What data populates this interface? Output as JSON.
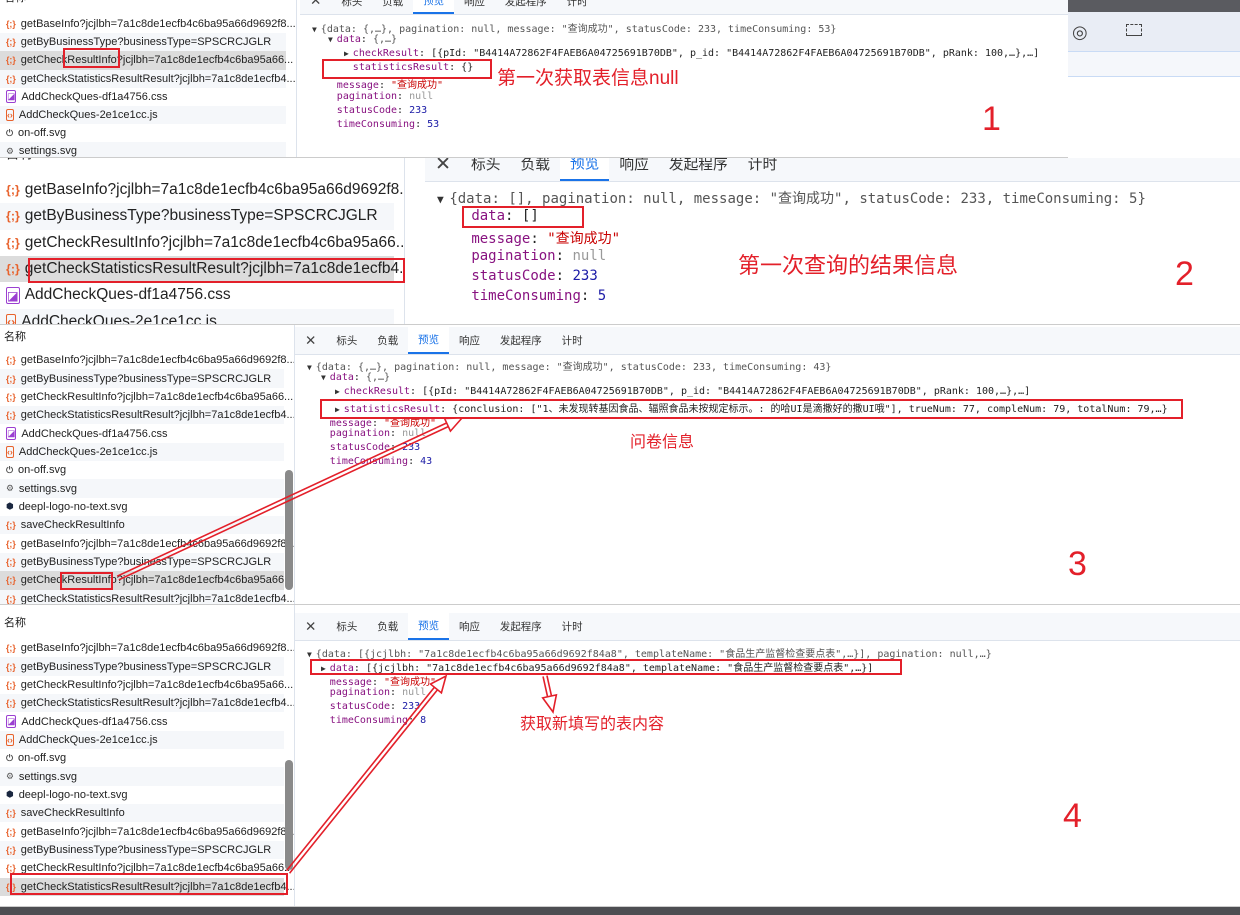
{
  "tabs": [
    "标头",
    "负载",
    "预览",
    "响应",
    "发起程序",
    "计时"
  ],
  "active_tab": "预览",
  "list_header": "名称",
  "colors": {
    "accent": "#1a73e8",
    "annotation": "#e3202a",
    "key": "#881280",
    "string": "#c80000",
    "number": "#1a1aa6"
  },
  "panels": [
    {
      "number": "1",
      "note": "第一次获取表信息null",
      "rows": [
        {
          "icon": "json",
          "name": "getBaseInfo?jcjlbh=7a1c8de1ecfb4c6ba95a66d9692f8..."
        },
        {
          "icon": "json",
          "name": "getByBusinessType?businessType=SPSCRCJGLR"
        },
        {
          "icon": "json",
          "name": "getCheckResultInfo?jcjlbh=7a1c8de1ecfb4c6ba95a66...",
          "selected": true
        },
        {
          "icon": "json",
          "name": "getCheckStatisticsResultResult?jcjlbh=7a1c8de1ecfb4..."
        },
        {
          "icon": "css",
          "name": "AddCheckQues-df1a4756.css"
        },
        {
          "icon": "js",
          "name": "AddCheckQues-2e1ce1cc.js"
        },
        {
          "icon": "power",
          "name": "on-off.svg"
        },
        {
          "icon": "gear",
          "name": "settings.svg"
        }
      ],
      "json": [
        {
          "indent": 0,
          "arrow": "down",
          "key": "",
          "value": "{data: {,…}, pagination: null, message: \"查询成功\", statusCode: 233, timeConsuming: 53}",
          "type": "summary"
        },
        {
          "indent": 1,
          "arrow": "down",
          "key": "data",
          "value": "{,…}",
          "type": "summary"
        },
        {
          "indent": 2,
          "arrow": "right",
          "key": "checkResult",
          "value": "[{pId: \"B4414A72862F4FAEB6A04725691B70DB\", p_id: \"B4414A72862F4FAEB6A04725691B70DB\", pRank: 100,…},…]",
          "type": "plain"
        },
        {
          "indent": 2,
          "arrow": "",
          "key": "statisticsResult",
          "value": "{}",
          "type": "plain"
        },
        {
          "indent": 1,
          "arrow": "",
          "key": "message",
          "value": "\"查询成功\"",
          "type": "string"
        },
        {
          "indent": 1,
          "arrow": "",
          "key": "pagination",
          "value": "null",
          "type": "null"
        },
        {
          "indent": 1,
          "arrow": "",
          "key": "statusCode",
          "value": "233",
          "type": "number"
        },
        {
          "indent": 1,
          "arrow": "",
          "key": "timeConsuming",
          "value": "53",
          "type": "number"
        }
      ]
    },
    {
      "number": "2",
      "note": "第一次查询的结果信息",
      "rows": [
        {
          "icon": "json",
          "name": "getBaseInfo?jcjlbh=7a1c8de1ecfb4c6ba95a66d9692f8..."
        },
        {
          "icon": "json",
          "name": "getByBusinessType?businessType=SPSCRCJGLR"
        },
        {
          "icon": "json",
          "name": "getCheckResultInfo?jcjlbh=7a1c8de1ecfb4c6ba95a66..."
        },
        {
          "icon": "json",
          "name": "getCheckStatisticsResultResult?jcjlbh=7a1c8de1ecfb4...",
          "selected": true
        },
        {
          "icon": "css",
          "name": "AddCheckQues-df1a4756.css"
        },
        {
          "icon": "js",
          "name": "AddCheckQues-2e1ce1cc.js"
        }
      ],
      "json": [
        {
          "indent": 0,
          "arrow": "down",
          "key": "",
          "value": "{data: [], pagination: null, message: \"查询成功\", statusCode: 233, timeConsuming: 5}",
          "type": "summary"
        },
        {
          "indent": 1,
          "arrow": "",
          "key": "data",
          "value": "[]",
          "type": "plain"
        },
        {
          "indent": 1,
          "arrow": "",
          "key": "message",
          "value": "\"查询成功\"",
          "type": "string"
        },
        {
          "indent": 1,
          "arrow": "",
          "key": "pagination",
          "value": "null",
          "type": "null"
        },
        {
          "indent": 1,
          "arrow": "",
          "key": "statusCode",
          "value": "233",
          "type": "number"
        },
        {
          "indent": 1,
          "arrow": "",
          "key": "timeConsuming",
          "value": "5",
          "type": "number"
        }
      ]
    },
    {
      "number": "3",
      "note": "问卷信息",
      "rows": [
        {
          "icon": "json",
          "name": "getBaseInfo?jcjlbh=7a1c8de1ecfb4c6ba95a66d9692f8..."
        },
        {
          "icon": "json",
          "name": "getByBusinessType?businessType=SPSCRCJGLR"
        },
        {
          "icon": "json",
          "name": "getCheckResultInfo?jcjlbh=7a1c8de1ecfb4c6ba95a66..."
        },
        {
          "icon": "json",
          "name": "getCheckStatisticsResultResult?jcjlbh=7a1c8de1ecfb4..."
        },
        {
          "icon": "css",
          "name": "AddCheckQues-df1a4756.css"
        },
        {
          "icon": "js",
          "name": "AddCheckQues-2e1ce1cc.js"
        },
        {
          "icon": "power",
          "name": "on-off.svg"
        },
        {
          "icon": "gear",
          "name": "settings.svg"
        },
        {
          "icon": "deepl",
          "name": "deepl-logo-no-text.svg"
        },
        {
          "icon": "json",
          "name": "saveCheckResultInfo"
        },
        {
          "icon": "json",
          "name": "getBaseInfo?jcjlbh=7a1c8de1ecfb4c6ba95a66d9692f8..."
        },
        {
          "icon": "json",
          "name": "getByBusinessType?businessType=SPSCRCJGLR"
        },
        {
          "icon": "json",
          "name": "getCheckResultInfo?jcjlbh=7a1c8de1ecfb4c6ba95a66...",
          "selected": true
        },
        {
          "icon": "json",
          "name": "getCheckStatisticsResultResult?jcjlbh=7a1c8de1ecfb4..."
        }
      ],
      "json": [
        {
          "indent": 0,
          "arrow": "down",
          "key": "",
          "value": "{data: {,…}, pagination: null, message: \"查询成功\", statusCode: 233, timeConsuming: 43}",
          "type": "summary"
        },
        {
          "indent": 1,
          "arrow": "down",
          "key": "data",
          "value": "{,…}",
          "type": "summary"
        },
        {
          "indent": 2,
          "arrow": "right",
          "key": "checkResult",
          "value": "[{pId: \"B4414A72862F4FAEB6A04725691B70DB\", p_id: \"B4414A72862F4FAEB6A04725691B70DB\", pRank: 100,…},…]",
          "type": "plain"
        },
        {
          "indent": 2,
          "arrow": "right",
          "key": "statisticsResult",
          "value": "{conclusion: [\"1、未发现转基因食品、辐照食品未按规定标示。: 的哈UI是滴撒好的撒UI哦\"], trueNum: 77, compleNum: 79, totalNum: 79,…}",
          "type": "plain"
        },
        {
          "indent": 1,
          "arrow": "",
          "key": "message",
          "value": "\"查询成功\"",
          "type": "string"
        },
        {
          "indent": 1,
          "arrow": "",
          "key": "pagination",
          "value": "null",
          "type": "null"
        },
        {
          "indent": 1,
          "arrow": "",
          "key": "statusCode",
          "value": "233",
          "type": "number"
        },
        {
          "indent": 1,
          "arrow": "",
          "key": "timeConsuming",
          "value": "43",
          "type": "number"
        }
      ]
    },
    {
      "number": "4",
      "note": "获取新填写的表内容",
      "rows": [
        {
          "icon": "json",
          "name": "getBaseInfo?jcjlbh=7a1c8de1ecfb4c6ba95a66d9692f8..."
        },
        {
          "icon": "json",
          "name": "getByBusinessType?businessType=SPSCRCJGLR"
        },
        {
          "icon": "json",
          "name": "getCheckResultInfo?jcjlbh=7a1c8de1ecfb4c6ba95a66..."
        },
        {
          "icon": "json",
          "name": "getCheckStatisticsResultResult?jcjlbh=7a1c8de1ecfb4..."
        },
        {
          "icon": "css",
          "name": "AddCheckQues-df1a4756.css"
        },
        {
          "icon": "js",
          "name": "AddCheckQues-2e1ce1cc.js"
        },
        {
          "icon": "power",
          "name": "on-off.svg"
        },
        {
          "icon": "gear",
          "name": "settings.svg"
        },
        {
          "icon": "deepl",
          "name": "deepl-logo-no-text.svg"
        },
        {
          "icon": "json",
          "name": "saveCheckResultInfo"
        },
        {
          "icon": "json",
          "name": "getBaseInfo?jcjlbh=7a1c8de1ecfb4c6ba95a66d9692f8..."
        },
        {
          "icon": "json",
          "name": "getByBusinessType?businessType=SPSCRCJGLR"
        },
        {
          "icon": "json",
          "name": "getCheckResultInfo?jcjlbh=7a1c8de1ecfb4c6ba95a66..."
        },
        {
          "icon": "json",
          "name": "getCheckStatisticsResultResult?jcjlbh=7a1c8de1ecfb4...",
          "selected": true
        }
      ],
      "json": [
        {
          "indent": 0,
          "arrow": "down",
          "key": "",
          "value": "{data: [{jcjlbh: \"7a1c8de1ecfb4c6ba95a66d9692f84a8\", templateName: \"食品生产监督检查要点表\",…}], pagination: null,…}",
          "type": "summary"
        },
        {
          "indent": 1,
          "arrow": "right",
          "key": "data",
          "value": "[{jcjlbh: \"7a1c8de1ecfb4c6ba95a66d9692f84a8\", templateName: \"食品生产监督检查要点表\",…}]",
          "type": "plain"
        },
        {
          "indent": 1,
          "arrow": "",
          "key": "message",
          "value": "\"查询成功\"",
          "type": "string"
        },
        {
          "indent": 1,
          "arrow": "",
          "key": "pagination",
          "value": "null",
          "type": "null"
        },
        {
          "indent": 1,
          "arrow": "",
          "key": "statusCode",
          "value": "233",
          "type": "number"
        },
        {
          "indent": 1,
          "arrow": "",
          "key": "timeConsuming",
          "value": "8",
          "type": "number"
        }
      ]
    }
  ],
  "side_toolbar": {
    "icons": [
      "eye-icon",
      "screenshot-rotate-icon"
    ]
  }
}
